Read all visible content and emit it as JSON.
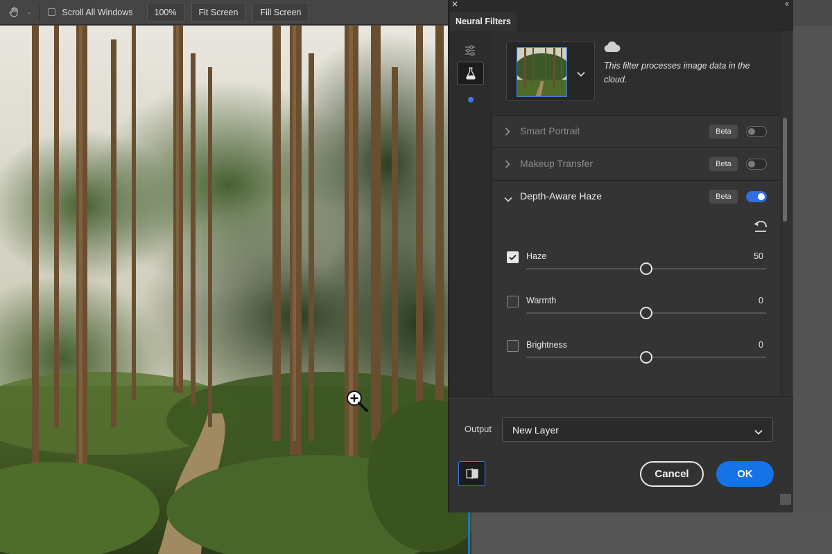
{
  "options_bar": {
    "scroll_all_windows_label": "Scroll All Windows",
    "zoom_100_label": "100%",
    "fit_screen_label": "Fit Screen",
    "fill_screen_label": "Fill Screen"
  },
  "panel": {
    "title": "Neural Filters",
    "cloud_notice": "This filter processes image data in the cloud.",
    "filters": [
      {
        "name": "Smart Portrait",
        "badge": "Beta",
        "enabled": false
      },
      {
        "name": "Makeup Transfer",
        "badge": "Beta",
        "enabled": false
      },
      {
        "name": "Depth-Aware Haze",
        "badge": "Beta",
        "enabled": true
      }
    ],
    "params": [
      {
        "label": "Haze",
        "value": "50",
        "checked": true,
        "slider_fraction": 0.5
      },
      {
        "label": "Warmth",
        "value": "0",
        "checked": false,
        "slider_fraction": 0.5
      },
      {
        "label": "Brightness",
        "value": "0",
        "checked": false,
        "slider_fraction": 0.5
      }
    ],
    "output": {
      "label": "Output",
      "value": "New Layer"
    },
    "cancel_label": "Cancel",
    "ok_label": "OK"
  },
  "icons": {
    "hand": "hand-tool-icon",
    "sliders": "sliders-icon",
    "flask": "flask-icon",
    "cloud": "cloud-icon",
    "reset": "reset-icon",
    "compare": "compare-icon",
    "zoom_cursor": "zoom-in-cursor-icon"
  },
  "colors": {
    "accent": "#1473e6",
    "panel_bg": "#323232"
  }
}
